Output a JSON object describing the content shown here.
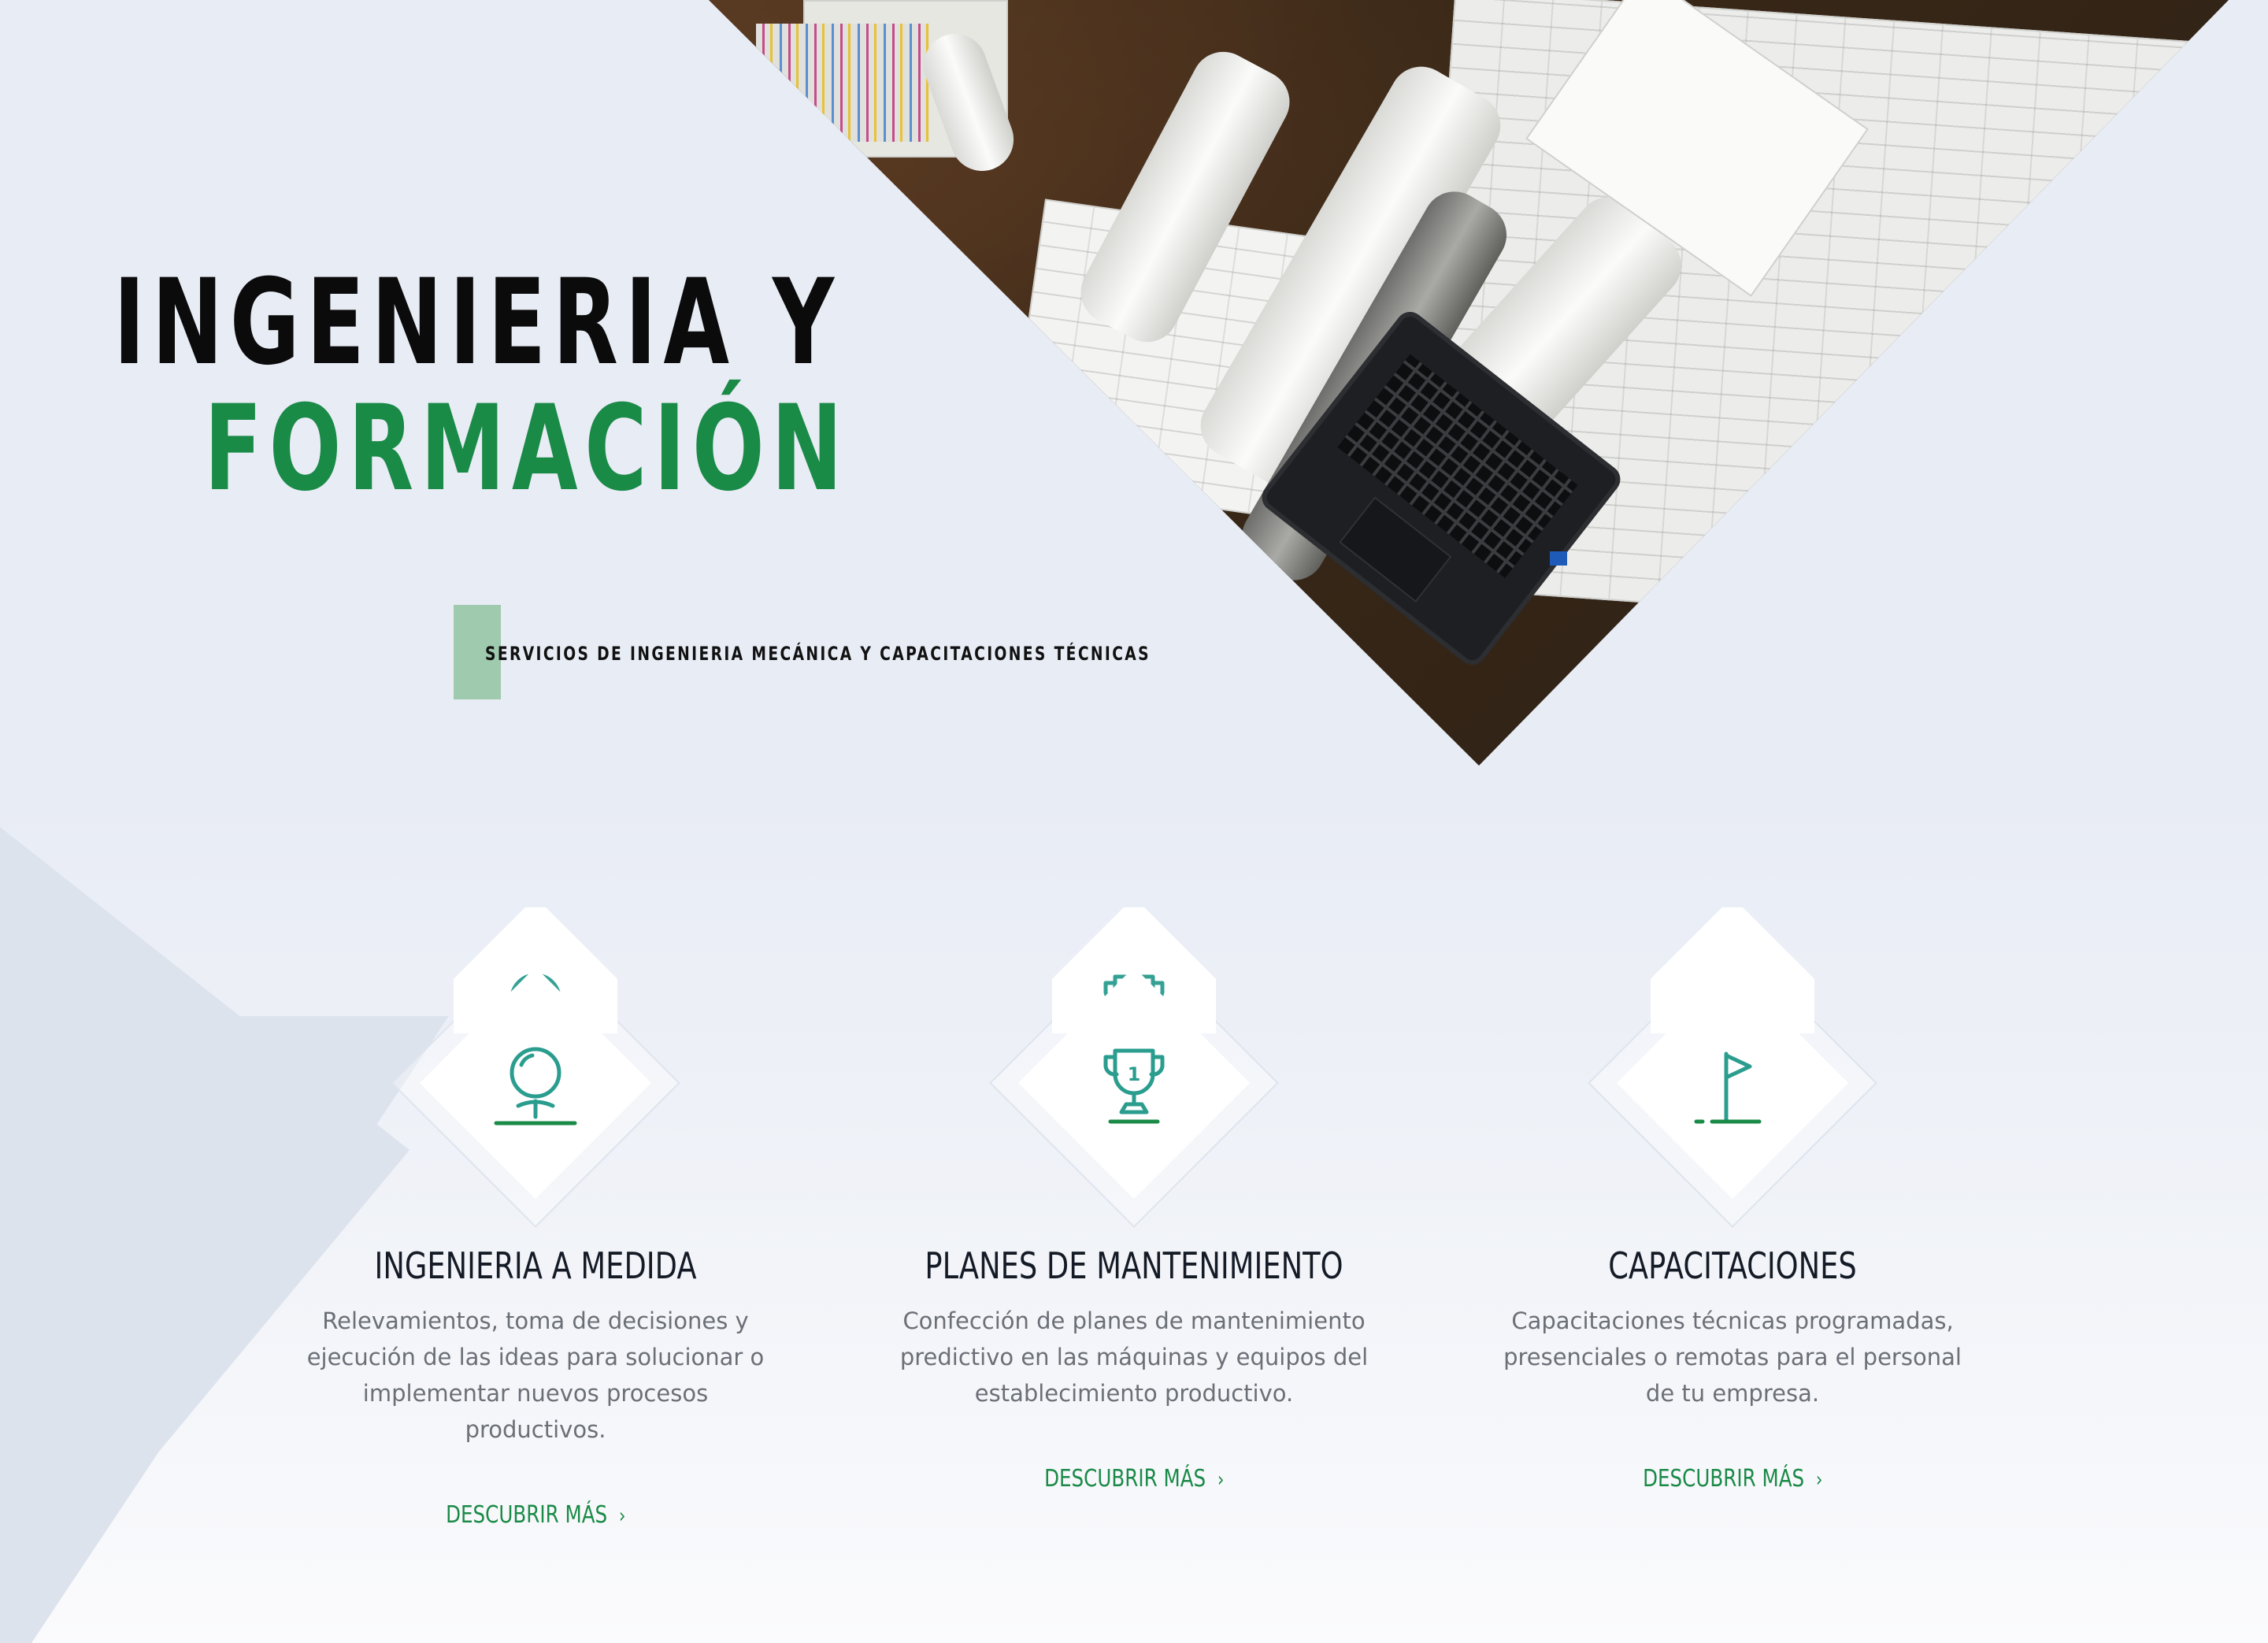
{
  "hero": {
    "title_line1": "INGENIERIA Y",
    "title_line2": "FORMACIÓN",
    "tagline": "SERVICIOS DE INGENIERIA MECÁNICA Y CAPACITACIONES TÉCNICAS",
    "accent_color": "#1a8a47"
  },
  "services": [
    {
      "icon": "golf-ball-on-tee-icon",
      "title": "INGENIERIA A MEDIDA",
      "description": "Relevamientos, toma de decisiones y ejecución de las ideas para solucionar o implementar nuevos procesos productivos.",
      "link": "DESCUBRIR MÁS",
      "link_icon": "›"
    },
    {
      "icon": "trophy-icon",
      "title": "PLANES DE MANTENIMIENTO",
      "description": "Confección de planes de mantenimiento predictivo en las máquinas y equipos del establecimiento productivo.",
      "link": "DESCUBRIR MÁS",
      "link_icon": "›"
    },
    {
      "icon": "flag-icon",
      "title": "CAPACITACIONES",
      "description": "Capacitaciones técnicas programadas, presenciales o remotas para el personal de tu empresa.",
      "link": "DESCUBRIR MÁS",
      "link_icon": "›"
    }
  ]
}
